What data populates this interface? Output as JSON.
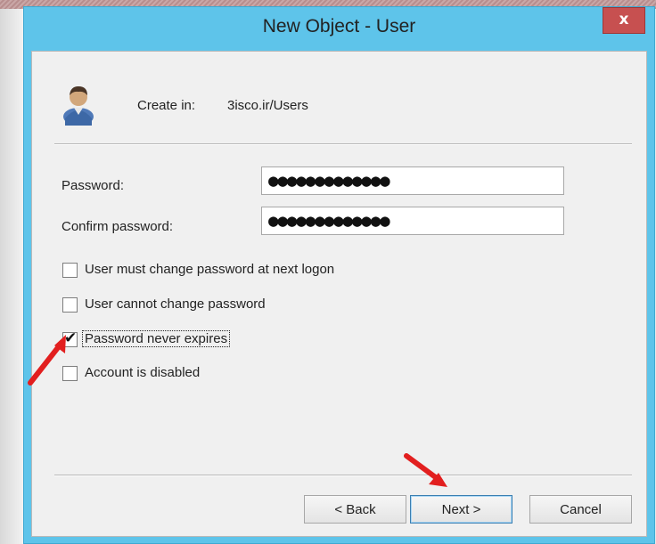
{
  "window": {
    "title": "New Object - User",
    "close_label": "x"
  },
  "header": {
    "create_in_label": "Create in:",
    "create_in_value": "3isco.ir/Users"
  },
  "fields": {
    "password_label": "Password:",
    "password_value": "●●●●●●●●●●●●●",
    "confirm_label": "Confirm password:",
    "confirm_value": "●●●●●●●●●●●●●"
  },
  "options": [
    {
      "label": "User must change password at next logon",
      "checked": false
    },
    {
      "label": "User cannot change password",
      "checked": false
    },
    {
      "label": "Password never expires",
      "checked": true
    },
    {
      "label": "Account is disabled",
      "checked": false
    }
  ],
  "buttons": {
    "back": "< Back",
    "next": "Next >",
    "cancel": "Cancel"
  },
  "colors": {
    "window_frame": "#5ec4ea",
    "close_button": "#c75050",
    "annotation_arrow": "#e21f1f"
  }
}
